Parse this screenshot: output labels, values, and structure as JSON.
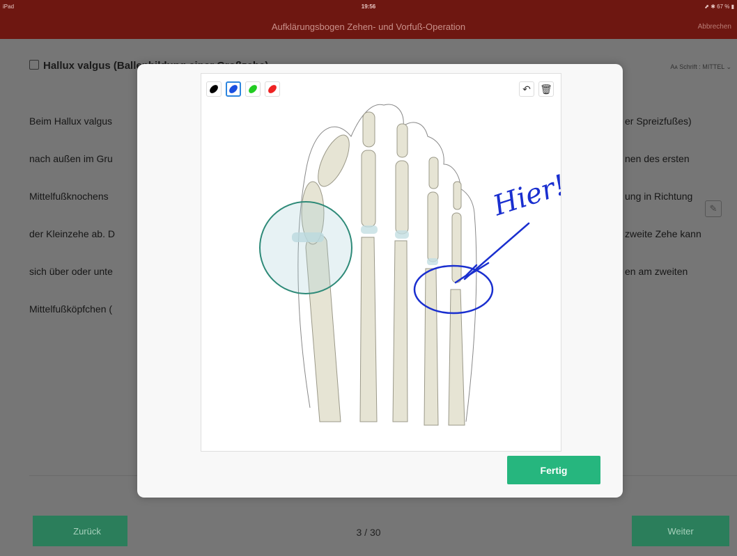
{
  "statusbar": {
    "left": "iPad",
    "time": "19:56",
    "battery": "67 %"
  },
  "navbar": {
    "title": "Aufklärungsbogen Zehen- und Vorfuß-Operation",
    "cancel": "Abbrechen"
  },
  "section": {
    "title": "Hallux valgus (Ballenbildung einer Großzehe)",
    "font_control": "Aᴀ Schrift : MITTEL ⌄"
  },
  "body_left": [
    "Beim Hallux valgus",
    "nach außen im Gru",
    "Mittelfußknochens",
    "der Kleinzehe ab. D",
    "sich über oder unte",
    "Mittelfußköpfchen ("
  ],
  "body_right": [
    "er Spreizfußes)",
    "nen des ersten",
    "ung in Richtung",
    "zweite Zehe kann",
    "en am zweiten"
  ],
  "icons": {
    "pencil": "pencil-icon",
    "undo": "undo-icon",
    "trash": "trash-icon"
  },
  "colors": {
    "accent_green": "#26b67e",
    "nav_red": "#6e1711",
    "pen_blue": "#1a2fcf"
  },
  "palette": [
    "#000000",
    "#1a4fe0",
    "#22cc22",
    "#ee2222"
  ],
  "annotation": "Hier!",
  "modal": {
    "done_label": "Fertig"
  },
  "pager": {
    "back_label": "Zurück",
    "next_label": "Weiter",
    "page": "3 / 30"
  }
}
